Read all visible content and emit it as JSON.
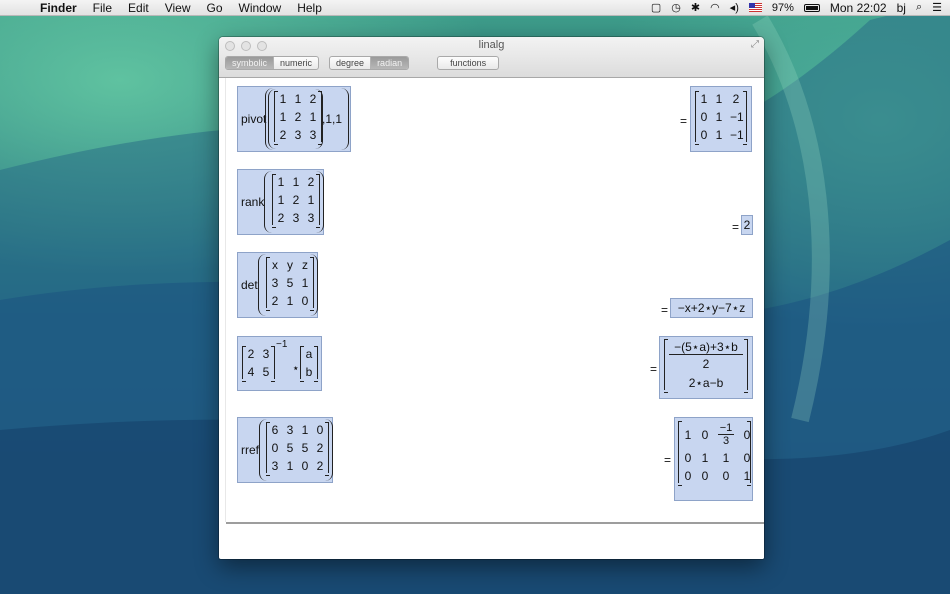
{
  "menubar": {
    "app": "Finder",
    "items": [
      "File",
      "Edit",
      "View",
      "Go",
      "Window",
      "Help"
    ],
    "battery": "97%",
    "clock": "Mon 22:02",
    "user": "bj",
    "icons": [
      "apple-icon",
      "square-icon",
      "time-machine-icon",
      "bluetooth-icon",
      "wifi-icon",
      "volume-icon",
      "flag-icon",
      "battery-icon",
      "search-icon",
      "list-icon"
    ]
  },
  "window": {
    "title": "linalg",
    "toolbar": {
      "mode": [
        "symbolic",
        "numeric"
      ],
      "mode_active": "symbolic",
      "angle": [
        "degree",
        "radian"
      ],
      "angle_active": "radian",
      "functions": "functions"
    }
  },
  "entries": [
    {
      "fn": "pivot",
      "matrix": [
        [
          "1",
          "1",
          "2"
        ],
        [
          "1",
          "2",
          "1"
        ],
        [
          "2",
          "3",
          "3"
        ]
      ],
      "args": ",1,1",
      "result_type": "matrix",
      "result": [
        [
          "1",
          "1",
          "2"
        ],
        [
          "0",
          "1",
          "−1"
        ],
        [
          "0",
          "1",
          "−1"
        ]
      ]
    },
    {
      "fn": "rank",
      "matrix": [
        [
          "1",
          "1",
          "2"
        ],
        [
          "1",
          "2",
          "1"
        ],
        [
          "2",
          "3",
          "3"
        ]
      ],
      "result_type": "scalar",
      "result": "2"
    },
    {
      "fn": "det",
      "matrix": [
        [
          "x",
          "y",
          "z"
        ],
        [
          "3",
          "5",
          "1"
        ],
        [
          "2",
          "1",
          "0"
        ]
      ],
      "result_type": "expression",
      "result": "−x+2⋆y−7⋆z"
    },
    {
      "fn": "",
      "matrix": [
        [
          "2",
          "3"
        ],
        [
          "4",
          "5"
        ]
      ],
      "exponent": "−1",
      "op": "⋆",
      "vector": [
        [
          "a"
        ],
        [
          "b"
        ]
      ],
      "result_type": "vector",
      "result_num": "−(5⋆a)+3⋆b",
      "result_den": "2",
      "result_row2": "2⋆a−b"
    },
    {
      "fn": "rref",
      "matrix": [
        [
          "6",
          "3",
          "1",
          "0"
        ],
        [
          "0",
          "5",
          "5",
          "2"
        ],
        [
          "3",
          "1",
          "0",
          "2"
        ]
      ],
      "result_type": "matrix",
      "result_row1_a": "1",
      "result_row1_b": "0",
      "result_row1_num": "−1",
      "result_row1_den": "3",
      "result_row1_d": "0",
      "result_rows": [
        [
          "0",
          "1",
          "1",
          "0"
        ],
        [
          "0",
          "0",
          "0",
          "1"
        ]
      ]
    }
  ],
  "equals": "="
}
